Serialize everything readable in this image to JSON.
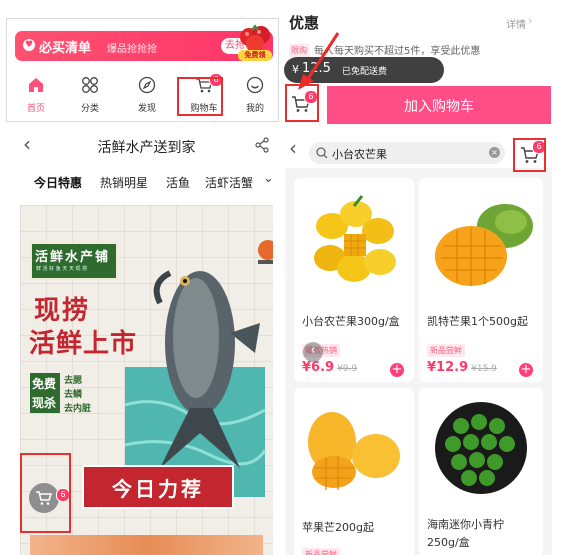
{
  "panel_home": {
    "banner": {
      "title": "必买清单",
      "subtitle": "爆品抢抢抢",
      "tag": "去抢",
      "corner_badge": "免费领"
    },
    "tabs": [
      {
        "label": "首页",
        "icon": "home-icon",
        "active": true
      },
      {
        "label": "分类",
        "icon": "grid-icon"
      },
      {
        "label": "发现",
        "icon": "compass-icon"
      },
      {
        "label": "购物车",
        "icon": "cart-icon",
        "badge": "6"
      },
      {
        "label": "我的",
        "icon": "smile-icon"
      }
    ]
  },
  "panel_product": {
    "promo_title": "优惠",
    "details_link": "详情",
    "limit_tag": "限购",
    "limit_text": "每人每天购买不超过5件，享受此优惠",
    "price_prefix": "¥",
    "price": "12.5",
    "shipping_text": "已免配送费",
    "cart_badge": "6",
    "add_to_cart": "加入购物车"
  },
  "panel_store": {
    "title": "活鲜水产送到家",
    "categories": [
      "今日特惠",
      "热销明星",
      "活鱼",
      "活虾活蟹"
    ],
    "active_category": "今日特惠",
    "poster": {
      "sign_title": "活鲜水产铺",
      "sign_sub": "鲜 活 好 鱼 天 天 现 捞",
      "headline_1": "现捞",
      "headline_2": "活鲜上市",
      "service_left_1": "免费",
      "service_left_2": "现杀",
      "service_right": [
        "去腮",
        "去鳞",
        "去内脏"
      ],
      "banner": "今日力荐"
    },
    "cart_badge": "6"
  },
  "panel_search": {
    "query": "小台农芒果",
    "cart_badge": "6",
    "products": [
      {
        "name": "小台农芒果300g/盒",
        "tag": "爆款热销",
        "price": "¥6.9",
        "original": "¥9.9"
      },
      {
        "name": "凯特芒果1个500g起",
        "tag": "新品尝鲜",
        "price": "¥12.9",
        "original": "¥15.9"
      },
      {
        "name": "苹果芒200g起",
        "tag": "新品尝鲜",
        "price": "",
        "original": ""
      },
      {
        "name": "海南迷你小青柠",
        "name_line2": "250g/盒",
        "tag": "",
        "price": "",
        "original": ""
      }
    ]
  },
  "colors": {
    "accent_pink": "#ff3c6e",
    "highlight_red": "#e8302f",
    "poster_red": "#c3262e",
    "sign_green": "#2f6b2e"
  }
}
